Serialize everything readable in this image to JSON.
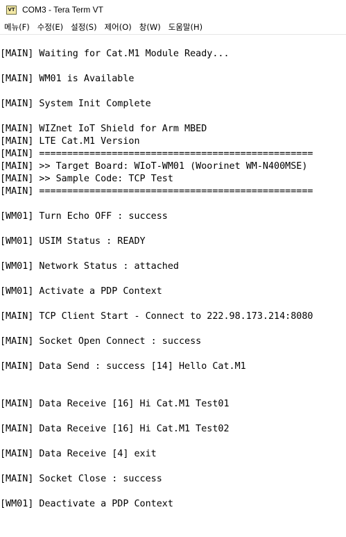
{
  "window": {
    "icon_label": "VT",
    "title": "COM3 - Tera Term VT"
  },
  "menu": {
    "items": [
      "메뉴(F)",
      "수정(E)",
      "설정(S)",
      "제어(O)",
      "창(W)",
      "도움말(H)"
    ]
  },
  "terminal": {
    "lines": [
      "[MAIN] Waiting for Cat.M1 Module Ready...",
      "[MAIN] WM01 is Available",
      "[MAIN] System Init Complete",
      "[MAIN] WIZnet IoT Shield for Arm MBED",
      "[MAIN] LTE Cat.M1 Version",
      "[MAIN] =================================================",
      "[MAIN] >> Target Board: WIoT-WM01 (Woorinet WM-N400MSE)",
      "[MAIN] >> Sample Code: TCP Test",
      "[MAIN] =================================================",
      "[WM01] Turn Echo OFF : success",
      "[WM01] USIM Status : READY",
      "[WM01] Network Status : attached",
      "[WM01] Activate a PDP Context",
      "[MAIN] TCP Client Start - Connect to 222.98.173.214:8080",
      "[MAIN] Socket Open Connect : success",
      "[MAIN] Data Send : success [14] Hello Cat.M1",
      "[MAIN] Data Receive [16] Hi Cat.M1 Test01",
      "[MAIN] Data Receive [16] Hi Cat.M1 Test02",
      "[MAIN] Data Receive [4] exit",
      "[MAIN] Socket Close : success",
      "[WM01] Deactivate a PDP Context"
    ]
  }
}
